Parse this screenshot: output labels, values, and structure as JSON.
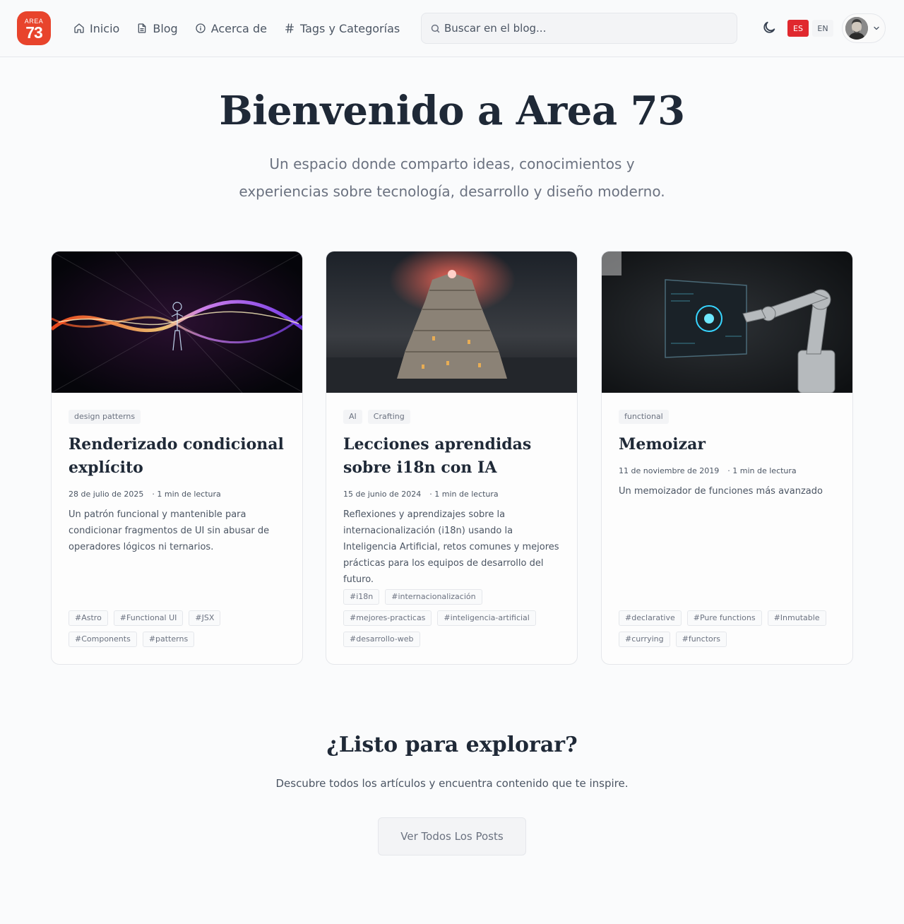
{
  "header": {
    "logo": {
      "top": "AREA",
      "number": "73"
    },
    "nav": [
      {
        "label": "Inicio",
        "icon": "home-icon"
      },
      {
        "label": "Blog",
        "icon": "document-icon"
      },
      {
        "label": "Acerca de",
        "icon": "info-icon"
      },
      {
        "label": "Tags y Categorías",
        "icon": "hash-icon"
      }
    ],
    "search_placeholder": "Buscar en el blog...",
    "languages": [
      "ES",
      "EN"
    ],
    "active_language": "ES"
  },
  "hero": {
    "title": "Bienvenido a Area 73",
    "subtitle": "Un espacio donde comparto ideas, conocimientos y experiencias sobre tecnología, desarrollo y diseño moderno."
  },
  "posts": [
    {
      "categories": [
        "design patterns"
      ],
      "title": "Renderizado condicional explícito",
      "date": "28 de julio de 2025",
      "reading": "· 1 min de lectura",
      "excerpt": "Un patrón funcional y mantenible para condicionar fragmentos de UI sin abusar de operadores lógicos ni ternarios.",
      "tags": [
        "#Astro",
        "#Functional UI",
        "#JSX",
        "#Components",
        "#patterns"
      ]
    },
    {
      "categories": [
        "AI",
        "Crafting"
      ],
      "title": "Lecciones aprendidas sobre i18n con IA",
      "date": "15 de junio de 2024",
      "reading": "· 1 min de lectura",
      "excerpt": "Reflexiones y aprendizajes sobre la internacionalización (i18n) usando la Inteligencia Artificial, retos comunes y mejores prácticas para los equipos de desarrollo del futuro.",
      "tags": [
        "#i18n",
        "#internacionalización",
        "#mejores-practicas",
        "#inteligencia-artificial",
        "#desarrollo-web"
      ]
    },
    {
      "categories": [
        "functional"
      ],
      "title": "Memoizar",
      "date": "11 de noviembre de 2019",
      "reading": "· 1 min de lectura",
      "excerpt": "Un memoizador de funciones más avanzado",
      "tags": [
        "#declarative",
        "#Pure functions",
        "#Inmutable",
        "#currying",
        "#functors"
      ]
    }
  ],
  "cta": {
    "title": "¿Listo para explorar?",
    "subtitle": "Descubre todos los artículos y encuentra contenido que te inspire.",
    "button": "Ver Todos Los Posts"
  },
  "colors": {
    "brand": "#e8442c",
    "lang_active": "#e0282e"
  }
}
